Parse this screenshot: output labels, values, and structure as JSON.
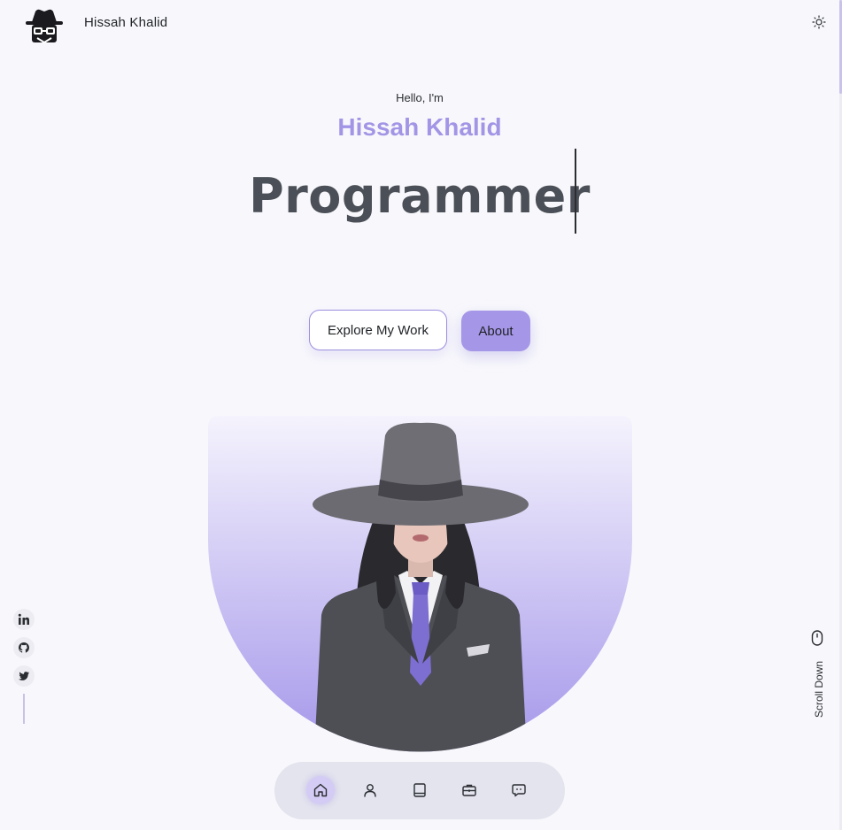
{
  "header": {
    "brand_name": "Hissah Khalid",
    "logo_icon": "spy-incognito-icon",
    "theme_toggle_icon": "sun-icon"
  },
  "hero": {
    "greeting": "Hello, I'm",
    "name": "Hissah Khalid",
    "role": "Programmer",
    "buttons": {
      "explore_label": "Explore My Work",
      "about_label": "About"
    },
    "portrait_alt": "Illustrated portrait of woman in hat and suit"
  },
  "social": {
    "items": [
      {
        "name": "linkedin",
        "icon": "linkedin-icon"
      },
      {
        "name": "github",
        "icon": "github-icon"
      },
      {
        "name": "twitter",
        "icon": "twitter-icon"
      }
    ]
  },
  "scroll": {
    "label": "Scroll Down",
    "icon": "mouse-icon"
  },
  "bottom_nav": {
    "items": [
      {
        "name": "home",
        "icon": "home-icon",
        "active": true
      },
      {
        "name": "about",
        "icon": "user-icon",
        "active": false
      },
      {
        "name": "skills",
        "icon": "book-icon",
        "active": false
      },
      {
        "name": "portfolio",
        "icon": "briefcase-icon",
        "active": false
      },
      {
        "name": "contact",
        "icon": "message-icon",
        "active": false
      }
    ]
  },
  "colors": {
    "accent": "#a395e6",
    "background": "#f8f8fc",
    "role_text": "#4b4f57",
    "nav_background": "#e3e4ee"
  }
}
